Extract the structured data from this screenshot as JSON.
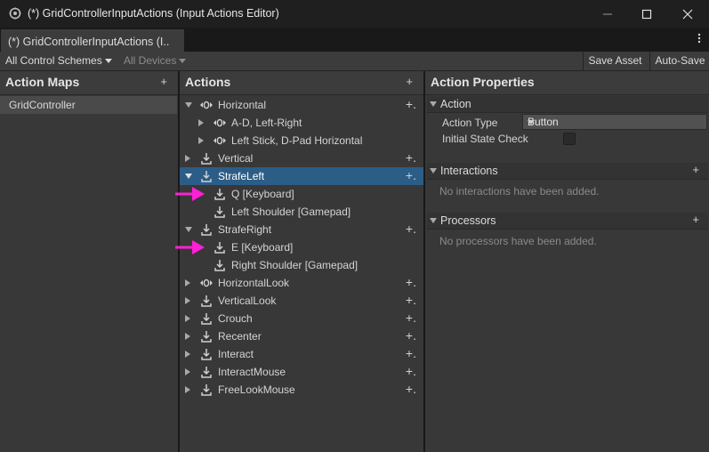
{
  "window": {
    "title": "(*) GridControllerInputActions (Input Actions Editor)",
    "tab_label": "(*) GridControllerInputActions (I..",
    "icons": {
      "app": "unity-settings-icon",
      "minimize": "minimize-icon",
      "maximize": "maximize-icon",
      "close": "close-icon",
      "menu": "kebab-menu-icon"
    }
  },
  "toolbar": {
    "control_schemes": "All Control Schemes",
    "devices": "All Devices",
    "save_asset": "Save Asset",
    "auto_save": "Auto-Save"
  },
  "action_maps": {
    "header": "Action Maps",
    "add": "+",
    "items": [
      {
        "label": "GridController"
      }
    ]
  },
  "actions": {
    "header": "Actions",
    "add": "+",
    "row_add": "+.",
    "items": [
      {
        "label": "Horizontal",
        "depth": 0,
        "fold": "down",
        "icon": "composite-icon",
        "plus": true
      },
      {
        "label": "A-D, Left-Right",
        "depth": 1,
        "fold": "right",
        "icon": "composite-icon",
        "plus": false
      },
      {
        "label": "Left Stick, D-Pad Horizontal",
        "depth": 1,
        "fold": "right",
        "icon": "composite-icon",
        "plus": false
      },
      {
        "label": "Vertical",
        "depth": 0,
        "fold": "right",
        "icon": "binding-icon",
        "plus": true
      },
      {
        "label": "StrafeLeft",
        "depth": 0,
        "fold": "down",
        "icon": "binding-icon",
        "plus": true,
        "selected": true
      },
      {
        "label": "Q [Keyboard]",
        "depth": 1,
        "fold": "none",
        "icon": "binding-icon",
        "plus": false,
        "marked": true
      },
      {
        "label": "Left Shoulder [Gamepad]",
        "depth": 1,
        "fold": "none",
        "icon": "binding-icon",
        "plus": false
      },
      {
        "label": "StrafeRight",
        "depth": 0,
        "fold": "down",
        "icon": "binding-icon",
        "plus": true
      },
      {
        "label": "E [Keyboard]",
        "depth": 1,
        "fold": "none",
        "icon": "binding-icon",
        "plus": false,
        "marked": true
      },
      {
        "label": "Right Shoulder [Gamepad]",
        "depth": 1,
        "fold": "none",
        "icon": "binding-icon",
        "plus": false
      },
      {
        "label": "HorizontalLook",
        "depth": 0,
        "fold": "right",
        "icon": "composite-icon",
        "plus": true
      },
      {
        "label": "VerticalLook",
        "depth": 0,
        "fold": "right",
        "icon": "binding-icon",
        "plus": true
      },
      {
        "label": "Crouch",
        "depth": 0,
        "fold": "right",
        "icon": "binding-icon",
        "plus": true
      },
      {
        "label": "Recenter",
        "depth": 0,
        "fold": "right",
        "icon": "binding-icon",
        "plus": true
      },
      {
        "label": "Interact",
        "depth": 0,
        "fold": "right",
        "icon": "binding-icon",
        "plus": true
      },
      {
        "label": "InteractMouse",
        "depth": 0,
        "fold": "right",
        "icon": "binding-icon",
        "plus": true
      },
      {
        "label": "FreeLookMouse",
        "depth": 0,
        "fold": "right",
        "icon": "binding-icon",
        "plus": true
      }
    ]
  },
  "properties": {
    "header": "Action Properties",
    "action_section": "Action",
    "action_type_label": "Action Type",
    "action_type_value": "Button",
    "initial_state_label": "Initial State Check",
    "interactions_section": "Interactions",
    "interactions_empty": "No interactions have been added.",
    "processors_section": "Processors",
    "processors_empty": "No processors have been added.",
    "add": "+"
  },
  "colors": {
    "selection": "#2c5d87",
    "annotation_arrow": "#ff1fd6"
  }
}
